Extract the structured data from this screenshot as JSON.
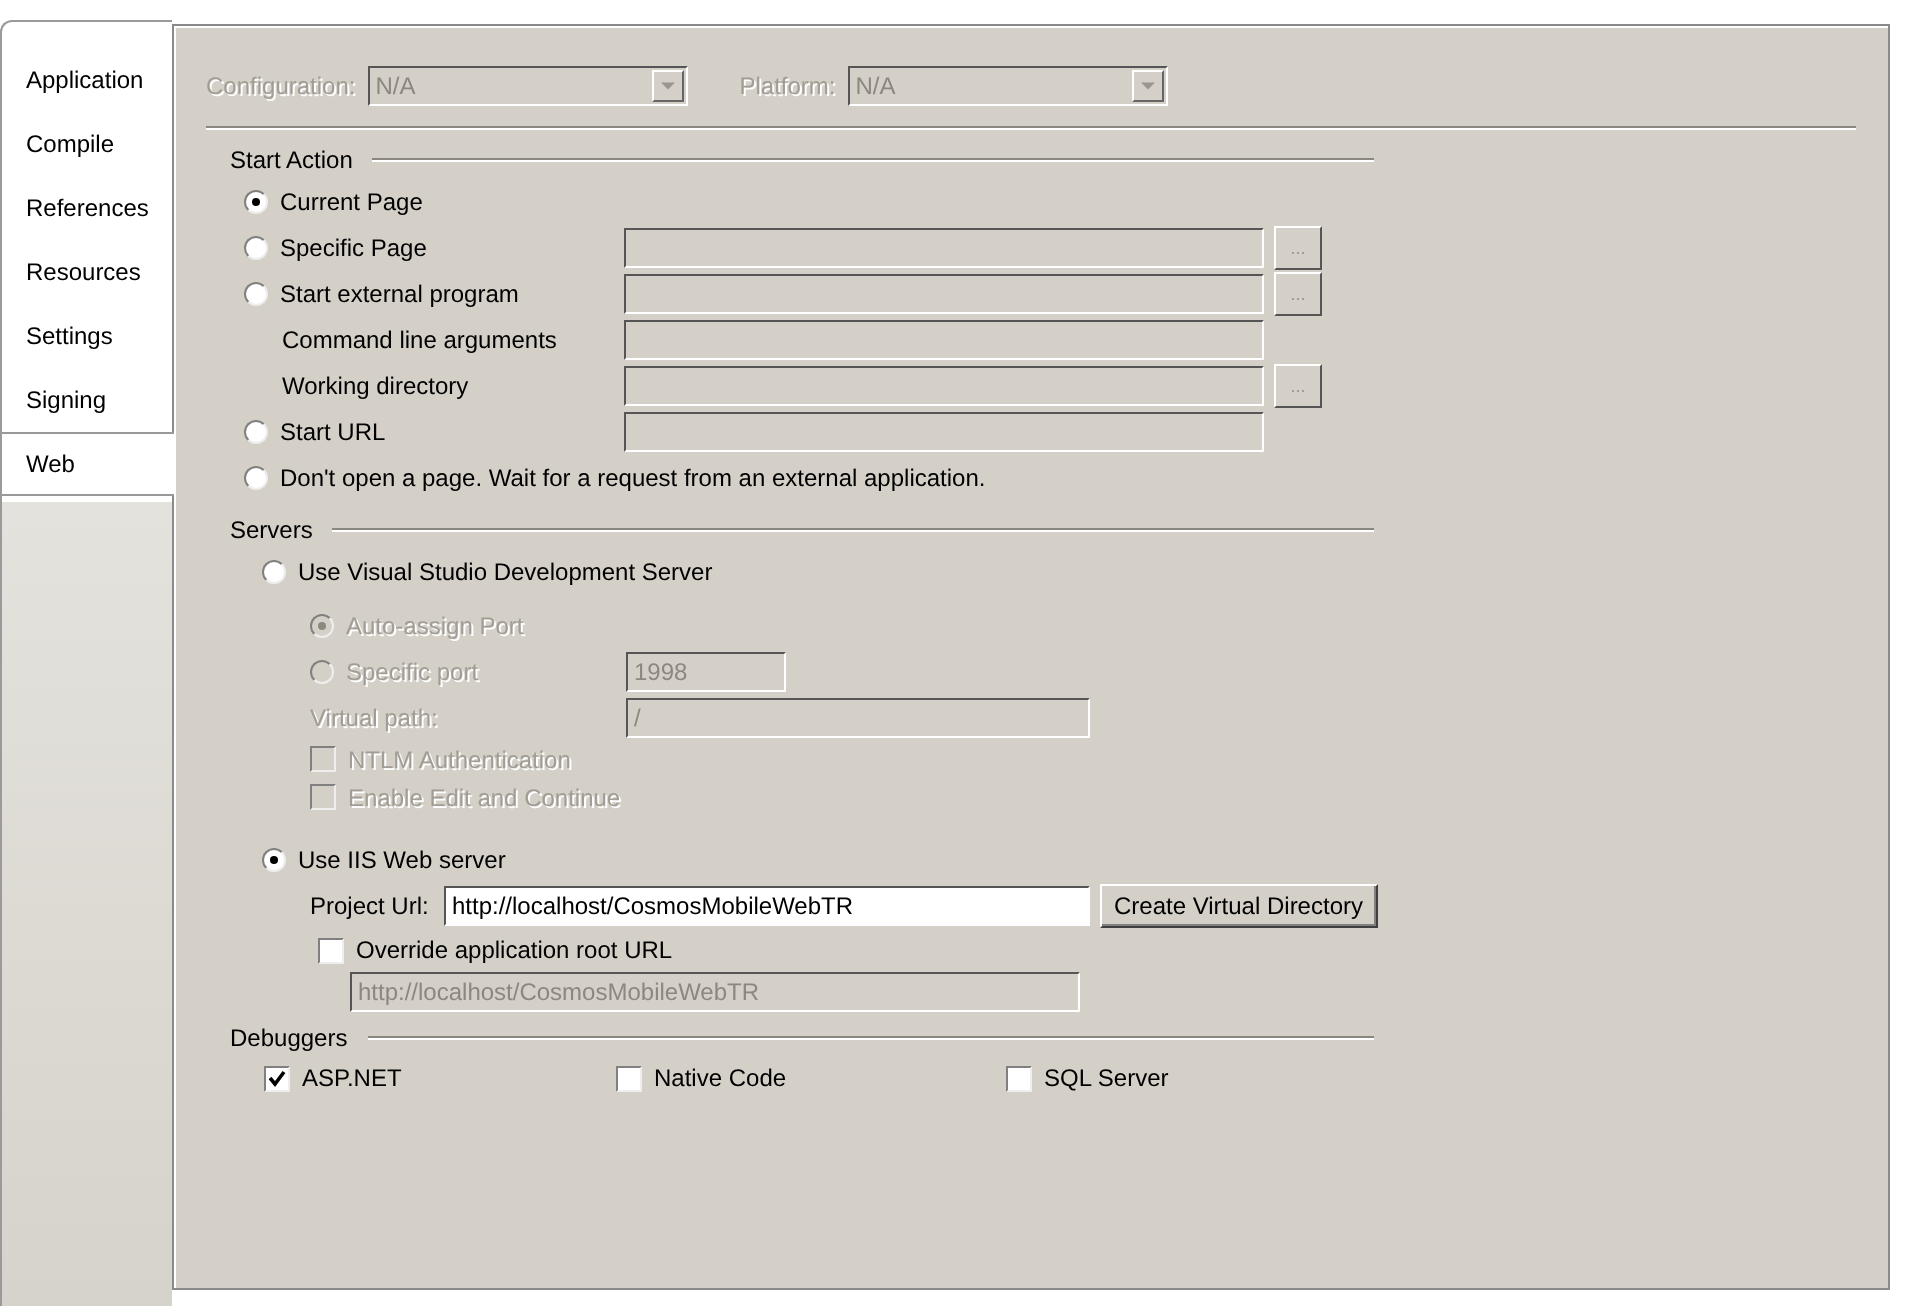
{
  "tabs": [
    {
      "label": "Application",
      "selected": false
    },
    {
      "label": "Compile",
      "selected": false
    },
    {
      "label": "References",
      "selected": false
    },
    {
      "label": "Resources",
      "selected": false
    },
    {
      "label": "Settings",
      "selected": false
    },
    {
      "label": "Signing",
      "selected": false
    },
    {
      "label": "Web",
      "selected": true
    }
  ],
  "configuration": {
    "label": "Configuration:",
    "value": "N/A",
    "disabled": true
  },
  "platform": {
    "label": "Platform:",
    "value": "N/A",
    "disabled": true
  },
  "start_action": {
    "title": "Start Action",
    "rows": [
      {
        "kind": "radio",
        "label": "Current Page",
        "selected": true
      },
      {
        "kind": "radio",
        "label": "Specific Page",
        "selected": false,
        "field": {
          "disabled": true
        },
        "browse": {
          "label": "...",
          "disabled": true
        }
      },
      {
        "kind": "radio",
        "label": "Start external program",
        "selected": false,
        "field": {
          "disabled": true
        },
        "browse": {
          "label": "...",
          "disabled": true
        }
      },
      {
        "kind": "label",
        "label": "Command line arguments",
        "field": {
          "disabled": true
        }
      },
      {
        "kind": "label",
        "label": "Working directory",
        "field": {
          "disabled": true
        },
        "browse": {
          "label": "...",
          "disabled": true
        }
      },
      {
        "kind": "radio",
        "label": "Start URL",
        "selected": false,
        "field": {
          "disabled": true
        }
      },
      {
        "kind": "radio",
        "label": "Don't open a page.  Wait for a request from an external application.",
        "selected": false
      }
    ]
  },
  "servers": {
    "title": "Servers",
    "dev_server": {
      "label": "Use Visual Studio Development Server",
      "selected": false,
      "rows": [
        {
          "kind": "radio",
          "label": "Auto-assign Port",
          "selected": true,
          "disabled": true
        },
        {
          "kind": "radio",
          "label": "Specific port",
          "selected": false,
          "disabled": true,
          "field": {
            "value": "1998",
            "disabled": true
          }
        },
        {
          "kind": "label",
          "label": "Virtual path:",
          "disabled": true,
          "field": {
            "value": "/",
            "disabled": true
          }
        },
        {
          "kind": "checkbox",
          "label": "NTLM Authentication",
          "checked": false,
          "disabled": true
        },
        {
          "kind": "checkbox",
          "label": "Enable Edit and Continue",
          "checked": false,
          "disabled": true
        }
      ]
    },
    "iis": {
      "label": "Use IIS Web server",
      "selected": true,
      "project_url": {
        "label": "Project Url:",
        "value": "http://localhost/CosmosMobileWebTR",
        "disabled": false
      },
      "create_button": "Create Virtual Directory",
      "override": {
        "label": "Override application root URL",
        "checked": false
      },
      "override_url": {
        "value": "http://localhost/CosmosMobileWebTR",
        "disabled": true
      }
    }
  },
  "debuggers": {
    "title": "Debuggers",
    "items": [
      {
        "label": "ASP.NET",
        "checked": true
      },
      {
        "label": "Native Code",
        "checked": false
      },
      {
        "label": "SQL Server",
        "checked": false
      }
    ]
  }
}
